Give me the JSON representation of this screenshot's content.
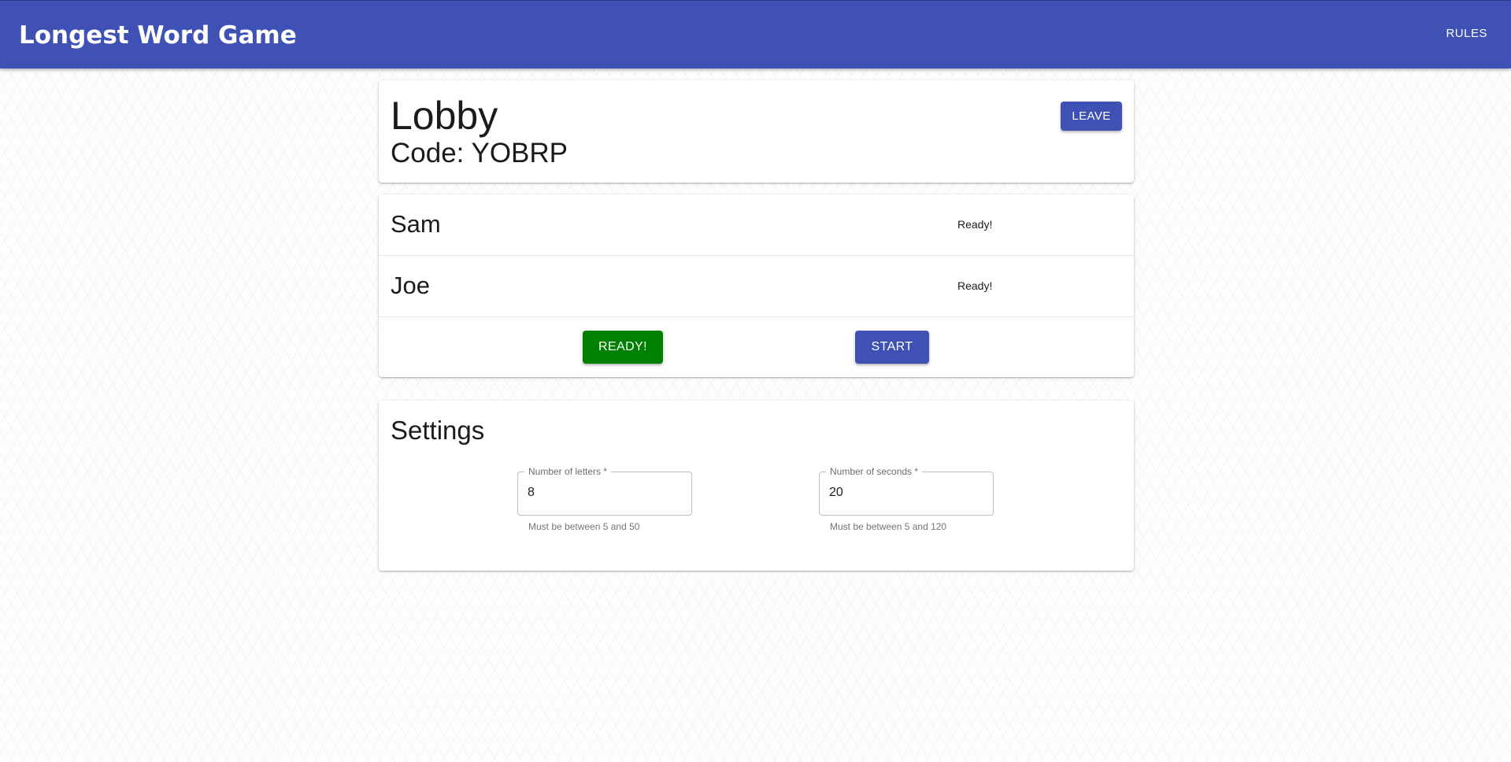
{
  "appbar": {
    "title": "Longest Word Game",
    "rules_label": "RULES",
    "color": "#3f51b5"
  },
  "lobby": {
    "title": "Lobby",
    "code_text": "Code: YOBRP",
    "leave_label": "LEAVE"
  },
  "players": [
    {
      "name": "Sam",
      "status": "Ready!"
    },
    {
      "name": "Joe",
      "status": "Ready!"
    }
  ],
  "actions": {
    "ready_label": "READY!",
    "ready_color": "#008000",
    "start_label": "START"
  },
  "settings": {
    "title": "Settings",
    "fields": [
      {
        "label": "Number of letters *",
        "value": "8",
        "help": "Must be between 5 and 50"
      },
      {
        "label": "Number of seconds *",
        "value": "20",
        "help": "Must be between 5 and 120"
      }
    ]
  }
}
